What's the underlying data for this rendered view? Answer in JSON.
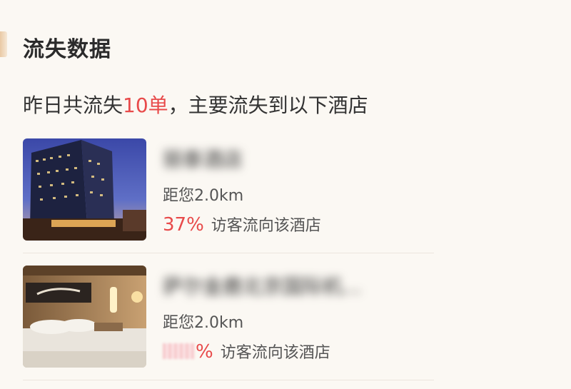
{
  "section": {
    "title": "流失数据"
  },
  "summary": {
    "prefix": "昨日共流失",
    "count": "10单",
    "suffix": "，主要流失到以下酒店"
  },
  "hotels": [
    {
      "name": "丽泰酒店",
      "distance": "距您2.0km",
      "percent": "37%",
      "percent_label": "访客流向该酒店"
    },
    {
      "name": "萨尔金鹿北京国际机...",
      "distance": "距您2.0km",
      "percent": "%",
      "percent_label": "访客流向该酒店"
    }
  ],
  "colors": {
    "accent": "#e84a4a",
    "background": "#fbf8f3"
  }
}
